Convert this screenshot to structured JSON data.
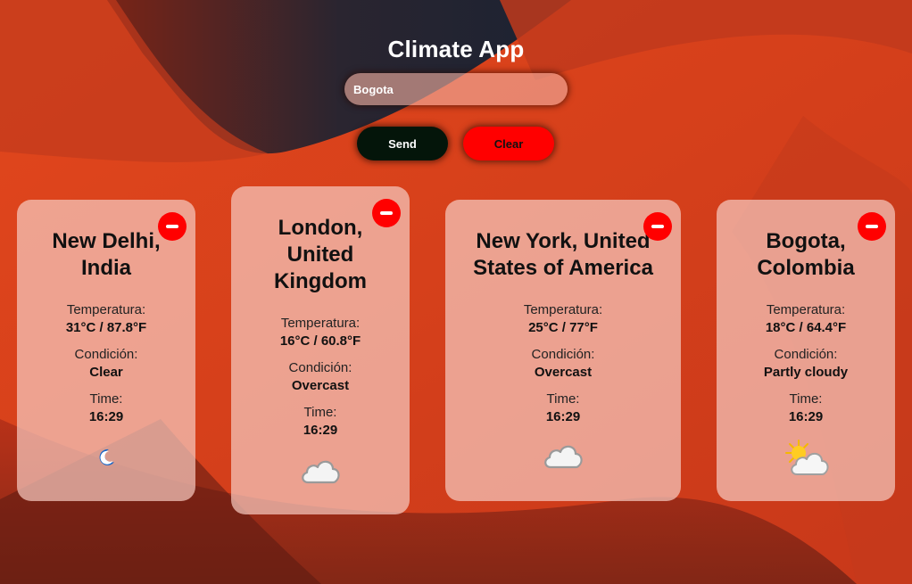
{
  "app": {
    "title": "Climate App",
    "search_value": "Bogota",
    "send_label": "Send",
    "clear_label": "Clear"
  },
  "labels": {
    "temperature": "Temperatura:",
    "condition": "Condición:",
    "time": "Time:"
  },
  "cards": [
    {
      "city_line1": "New Delhi,",
      "city_line2": "India",
      "temperature": "31°C / 87.8°F",
      "condition": "Clear",
      "time": "16:29",
      "icon": "moon-icon"
    },
    {
      "city_line1": "London,",
      "city_line2": "United",
      "city_line3": "Kingdom",
      "temperature": "16°C / 60.8°F",
      "condition": "Overcast",
      "time": "16:29",
      "icon": "cloud-icon"
    },
    {
      "city_line1": "New York, United",
      "city_line2": "States of America",
      "temperature": "25°C / 77°F",
      "condition": "Overcast",
      "time": "16:29",
      "icon": "cloud-icon"
    },
    {
      "city_line1": "Bogota,",
      "city_line2": "Colombia",
      "temperature": "18°C / 64.4°F",
      "condition": "Partly cloudy",
      "time": "16:29",
      "icon": "sun-cloud-icon"
    }
  ],
  "colors": {
    "background": "#d8401c",
    "dark_swoop": "#1e2430",
    "send_button": "#04150a",
    "clear_button": "#ff0000",
    "remove_button": "#ff0000"
  }
}
